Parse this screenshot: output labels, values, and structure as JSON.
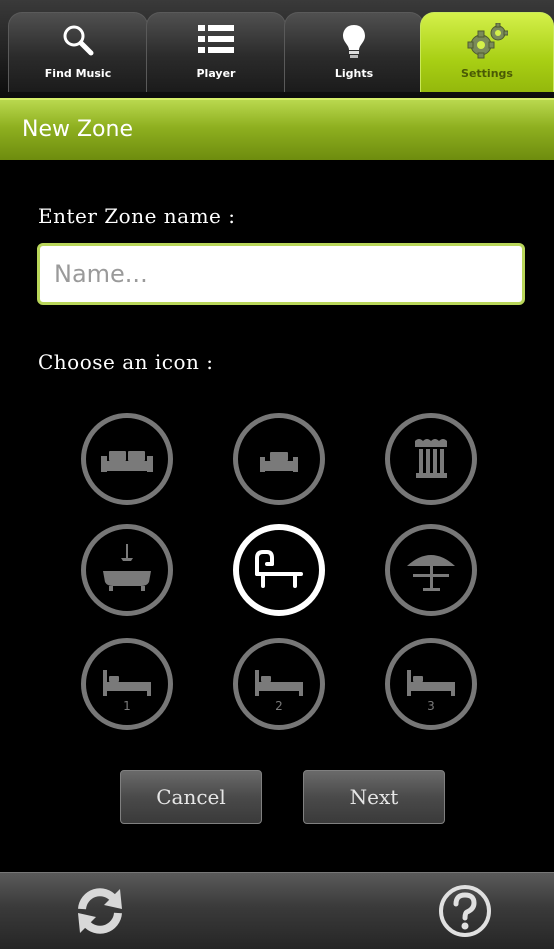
{
  "tabs": [
    {
      "label": "Find Music",
      "icon": "search-icon"
    },
    {
      "label": "Player",
      "icon": "list-icon"
    },
    {
      "label": "Lights",
      "icon": "bulb-icon"
    },
    {
      "label": "Settings",
      "icon": "gear-icon",
      "active": true
    }
  ],
  "header": {
    "title": "New Zone"
  },
  "form": {
    "name_label": "Enter Zone name :",
    "name_placeholder": "Name...",
    "name_value": "",
    "icon_label": "Choose an icon :"
  },
  "zone_icons": [
    {
      "icon": "sofa-icon",
      "selected": false
    },
    {
      "icon": "armchair-icon",
      "selected": false
    },
    {
      "icon": "column-icon",
      "selected": false
    },
    {
      "icon": "bathtub-icon",
      "selected": false
    },
    {
      "icon": "lounge-chair-icon",
      "selected": true
    },
    {
      "icon": "umbrella-table-icon",
      "selected": false
    },
    {
      "icon": "bed-icon",
      "number": "1",
      "selected": false
    },
    {
      "icon": "bed-icon",
      "number": "2",
      "selected": false
    },
    {
      "icon": "bed-icon",
      "number": "3",
      "selected": false
    }
  ],
  "buttons": {
    "cancel": "Cancel",
    "next": "Next"
  },
  "bottom_bar": {
    "left_icon": "refresh-icon",
    "right_icon": "help-icon"
  },
  "colors": {
    "accent": "#9fc31c",
    "selected_ring": "#ffffff",
    "ring": "#777777"
  }
}
